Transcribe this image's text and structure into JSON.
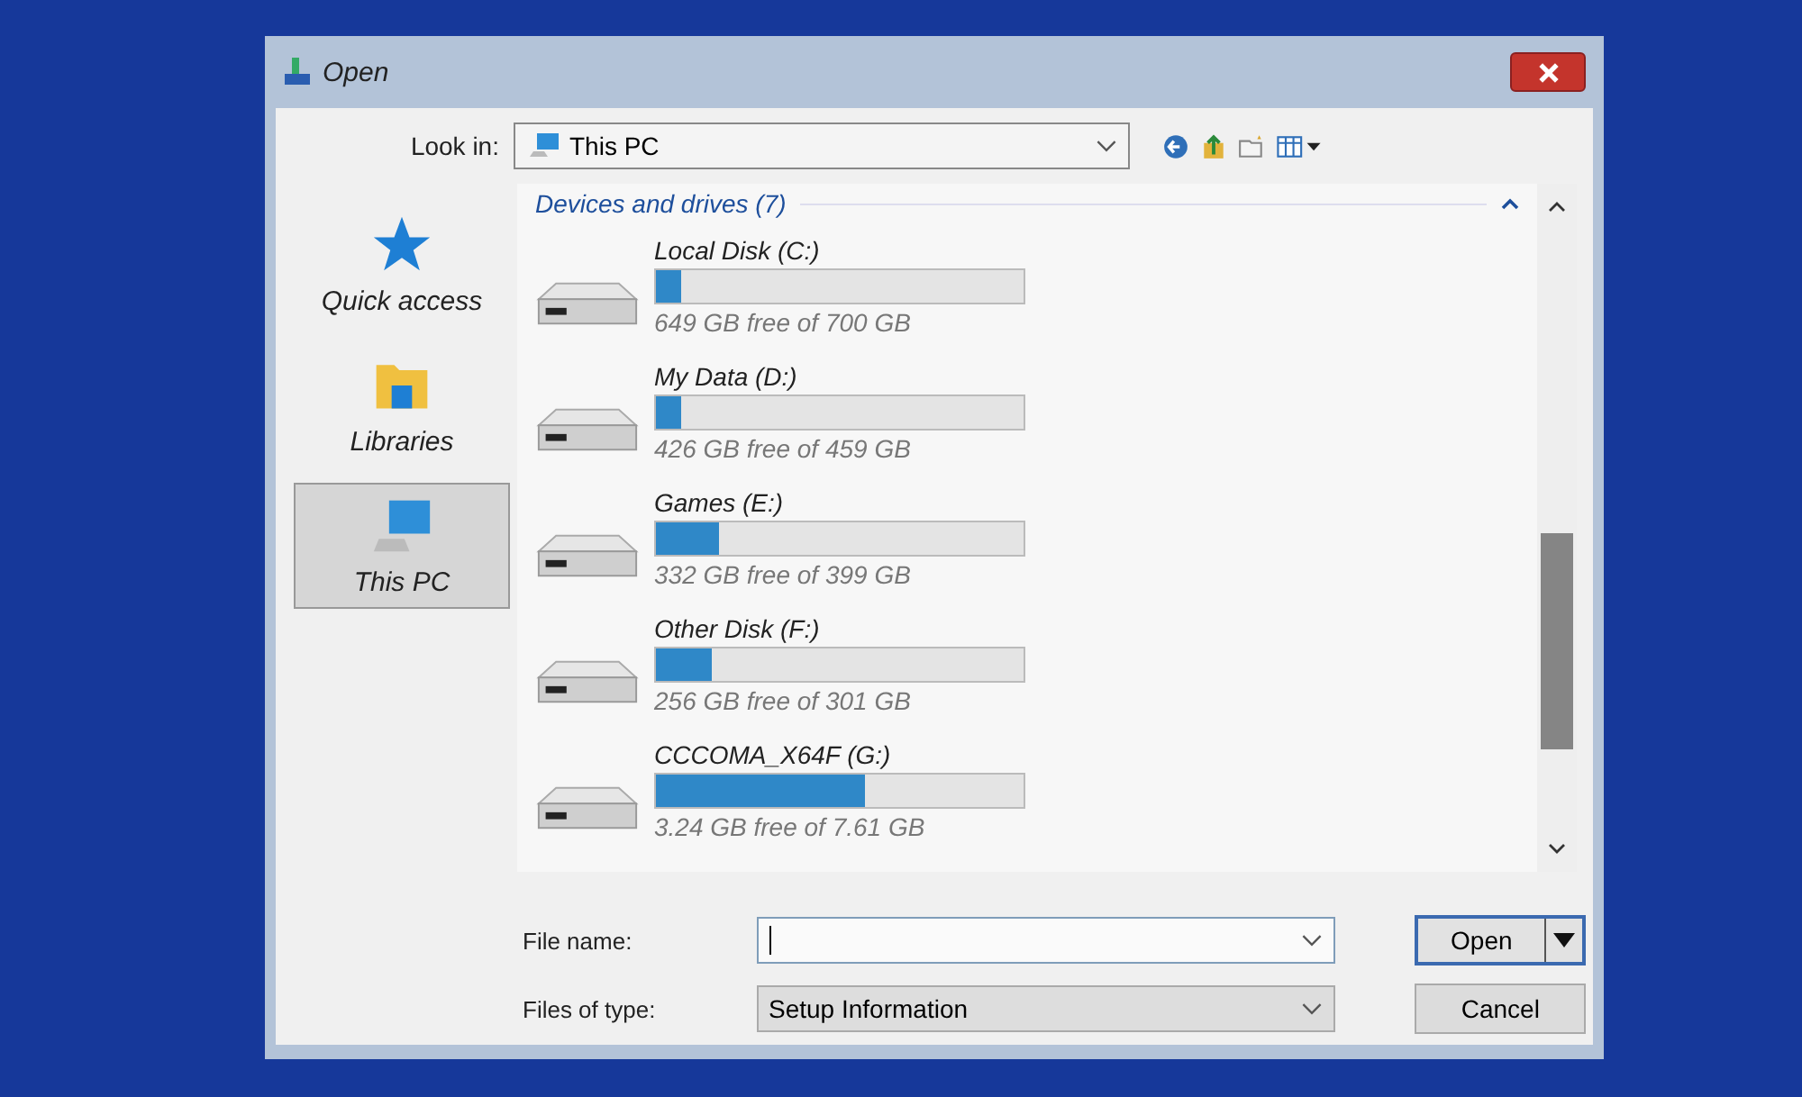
{
  "window": {
    "title": "Open"
  },
  "look_in": {
    "label": "Look in:",
    "value": "This PC"
  },
  "places": [
    {
      "label": "Quick access",
      "kind": "star",
      "selected": false
    },
    {
      "label": "Libraries",
      "kind": "library",
      "selected": false
    },
    {
      "label": "This PC",
      "kind": "pc",
      "selected": true
    }
  ],
  "group": {
    "title": "Devices and drives (7)",
    "expanded": true
  },
  "drives": [
    {
      "name": "Local Disk (C:)",
      "level": 0.07,
      "free": "649 GB free of 700 GB"
    },
    {
      "name": "My Data (D:)",
      "level": 0.07,
      "free": "426 GB free of 459 GB"
    },
    {
      "name": "Games (E:)",
      "level": 0.17,
      "free": "332 GB free of 399 GB"
    },
    {
      "name": "Other Disk (F:)",
      "level": 0.15,
      "free": "256 GB free of 301 GB"
    },
    {
      "name": "CCCOMA_X64F (G:)",
      "level": 0.57,
      "free": "3.24 GB free of 7.61 GB"
    }
  ],
  "file_name": {
    "label": "File name:"
  },
  "file_type": {
    "label": "Files of type:",
    "value": "Setup Information"
  },
  "buttons": {
    "open": "Open",
    "cancel": "Cancel"
  }
}
